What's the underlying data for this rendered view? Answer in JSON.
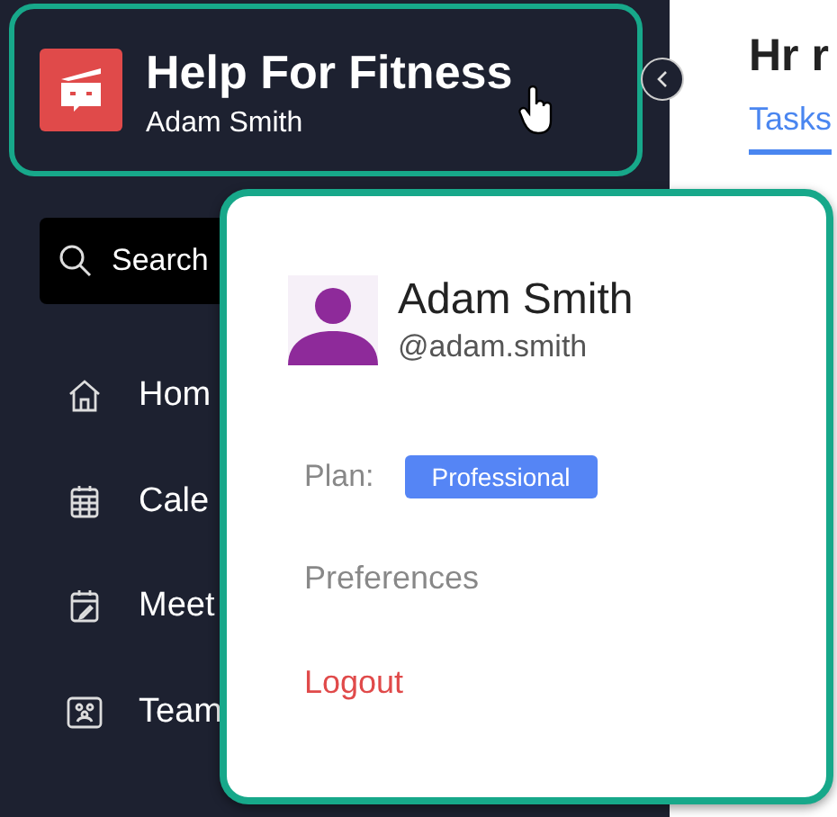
{
  "app": {
    "title": "Help For Fitness",
    "user": "Adam Smith"
  },
  "search": {
    "placeholder": "Search"
  },
  "nav": [
    {
      "label": "Hom",
      "kind": "home"
    },
    {
      "label": "Cale",
      "kind": "calendar"
    },
    {
      "label": "Meet",
      "kind": "meeting"
    },
    {
      "label": "Team",
      "kind": "team"
    }
  ],
  "main": {
    "title": "Hr r",
    "tabs": [
      {
        "label": "Tasks",
        "selected": true
      }
    ]
  },
  "popup": {
    "name": "Adam Smith",
    "handle": "@adam.smith",
    "plan_label": "Plan:",
    "plan": "Professional",
    "items": [
      {
        "label": "Preferences",
        "kind": "link"
      },
      {
        "label": "Logout",
        "kind": "danger"
      }
    ]
  }
}
